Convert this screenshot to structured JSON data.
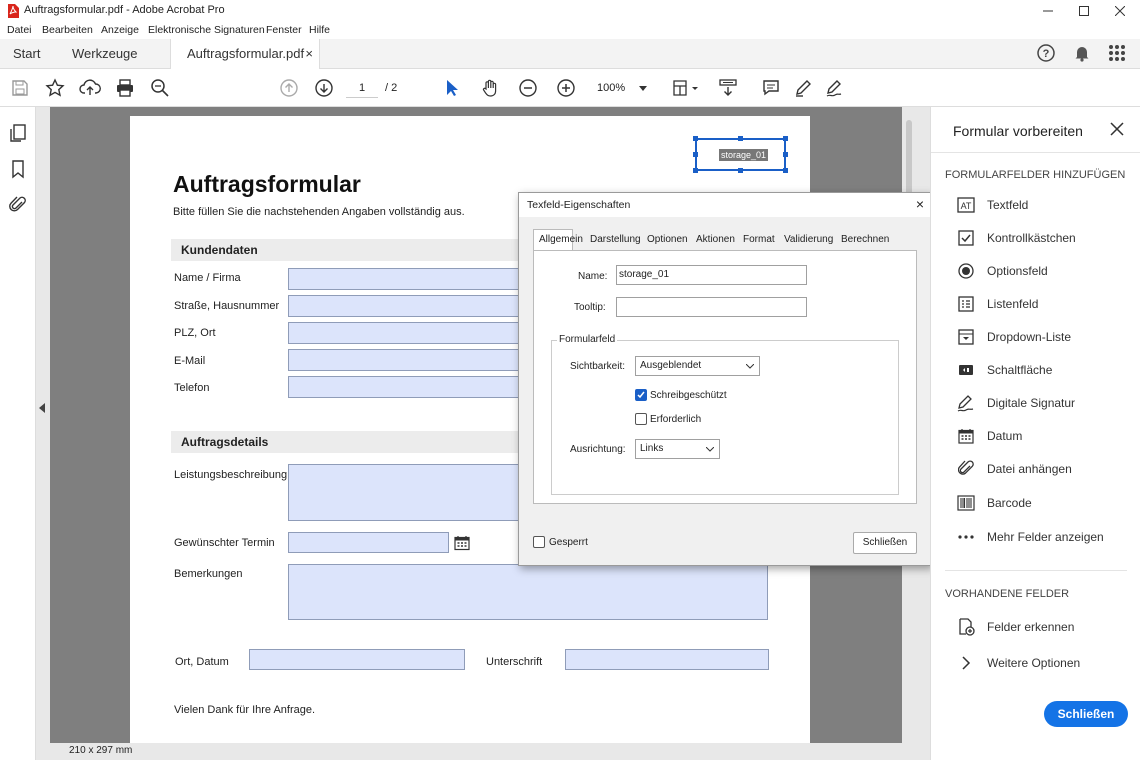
{
  "window": {
    "title": "Auftragsformular.pdf - Adobe Acrobat Pro"
  },
  "menu": [
    "Datei",
    "Bearbeiten",
    "Anzeige",
    "Elektronische Signaturen",
    "Fenster",
    "Hilfe"
  ],
  "tabs": {
    "start": "Start",
    "tools": "Werkzeuge",
    "doc": "Auftragsformular.pdf",
    "close": "×"
  },
  "toolbar": {
    "page_current": "1",
    "page_total": "/ 2",
    "zoom": "100%"
  },
  "document": {
    "title": "Auftragsformular",
    "intro": "Bitte füllen Sie die nachstehenden Angaben vollständig aus.",
    "selected_field": "storage_01",
    "section1": "Kundendaten",
    "fields1": [
      "Name / Firma",
      "Straße, Hausnummer",
      "PLZ, Ort",
      "E-Mail",
      "Telefon"
    ],
    "section2": "Auftragsdetails",
    "desc_label": "Leistungsbeschreibung",
    "date_label": "Gewünschter Termin",
    "notes_label": "Bemerkungen",
    "place_label": "Ort, Datum",
    "sign_label": "Unterschrift",
    "thanks": "Vielen Dank für Ihre Anfrage."
  },
  "status": {
    "page_size": "210 x 297 mm"
  },
  "dialog": {
    "title": "Texfeld-Eigenschaften",
    "close": "×",
    "tabs": [
      "Allgemein",
      "Darstellung",
      "Optionen",
      "Aktionen",
      "Format",
      "Validierung",
      "Berechnen"
    ],
    "active_tab": "Allgemein",
    "name_label": "Name:",
    "name_value": "storage_01",
    "tooltip_label": "Tooltip:",
    "tooltip_value": "",
    "group_label": "Formularfeld",
    "visibility_label": "Sichtbarkeit:",
    "visibility_value": "Ausgeblendet",
    "readonly_label": "Schreibgeschützt",
    "readonly_checked": true,
    "required_label": "Erforderlich",
    "required_checked": false,
    "orientation_label": "Ausrichtung:",
    "orientation_value": "Links",
    "locked_label": "Gesperrt",
    "locked_checked": false,
    "close_button": "Schließen"
  },
  "panel": {
    "title": "Formular vorbereiten",
    "section_add": "FORMULARFELDER HINZUFÜGEN",
    "items": [
      {
        "label": "Textfeld",
        "icon": "text-field-icon"
      },
      {
        "label": "Kontrollkästchen",
        "icon": "checkbox-icon"
      },
      {
        "label": "Optionsfeld",
        "icon": "radio-button-icon"
      },
      {
        "label": "Listenfeld",
        "icon": "list-box-icon"
      },
      {
        "label": "Dropdown-Liste",
        "icon": "dropdown-icon"
      },
      {
        "label": "Schaltfläche",
        "icon": "button-icon"
      },
      {
        "label": "Digitale Signatur",
        "icon": "digital-signature-icon"
      },
      {
        "label": "Datum",
        "icon": "date-icon"
      },
      {
        "label": "Datei anhängen",
        "icon": "attach-file-icon"
      },
      {
        "label": "Barcode",
        "icon": "barcode-icon"
      },
      {
        "label": "Mehr Felder anzeigen",
        "icon": "more-icon"
      }
    ],
    "section_existing": "VORHANDENE FELDER",
    "detect_label": "Felder erkennen",
    "more_options_label": "Weitere Optionen",
    "close_button": "Schließen"
  },
  "colors": {
    "accent": "#1473e6",
    "field_fill": "#dce4fb",
    "selection": "#1a5fc7"
  }
}
